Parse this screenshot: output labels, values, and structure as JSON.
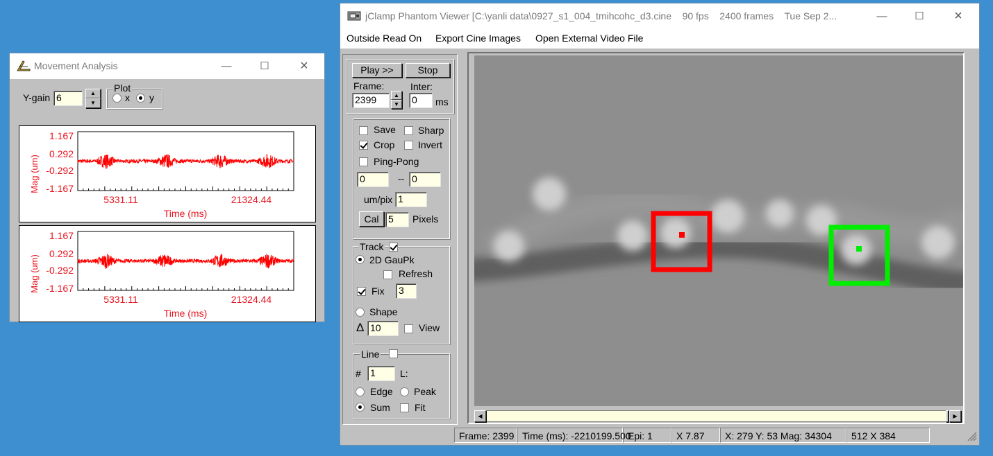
{
  "movement": {
    "title": "Movement Analysis",
    "ygain_label": "Y-gain",
    "ygain_value": "6",
    "plot_group_label": "Plot",
    "plot_x_label": "x",
    "plot_y_label": "y",
    "plot_selected": "y"
  },
  "chart_data": [
    {
      "type": "line",
      "ylabel": "Mag (um)",
      "xlabel": "Time (ms)",
      "yticks": [
        "1.167",
        "0.292",
        "-0.292",
        "-1.167"
      ],
      "xticks": [
        "5331.11",
        "21324.44"
      ],
      "ylim": [
        -1.167,
        1.167
      ],
      "series_color": "#ff0000",
      "bursts": [
        0.13,
        0.41,
        0.66,
        0.88
      ]
    },
    {
      "type": "line",
      "ylabel": "Mag (um)",
      "xlabel": "Time (ms)",
      "yticks": [
        "1.167",
        "0.292",
        "-0.292",
        "-1.167"
      ],
      "xticks": [
        "5331.11",
        "21324.44"
      ],
      "ylim": [
        -1.167,
        1.167
      ],
      "series_color": "#ff0000",
      "bursts": [
        0.13,
        0.4,
        0.66,
        0.88
      ]
    }
  ],
  "viewer": {
    "title": "jClamp Phantom Viewer [C:\\yanli data\\0927_s1_004_tmihcohc_d3.cine    90 fps    2400 frames    Tue Sep 2...",
    "menu": [
      "Outside Read On",
      "Export Cine Images",
      "Open External Video File"
    ],
    "play_label": "Play >>",
    "stop_label": "Stop",
    "frame_label": "Frame:",
    "frame_value": "2399",
    "inter_label": "Inter:",
    "inter_value": "0",
    "inter_unit": "ms",
    "save_label": "Save",
    "sharp_label": "Sharp",
    "crop_label": "Crop",
    "invert_label": "Invert",
    "pingpong_label": "Ping-Pong",
    "range_from": "0",
    "range_sep": "--",
    "range_to": "0",
    "umpix_label": "um/pix",
    "umpix_value": "1",
    "cal_label": "Cal",
    "cal_value": "5",
    "pixels_label": "Pixels",
    "track_label": "Track",
    "gaupk_label": "2D GauPk",
    "refresh_label": "Refresh",
    "fix_label": "Fix",
    "fix_value": "3",
    "shape_label": "Shape",
    "delta_symbol": "Δ",
    "delta_value": "10",
    "view_label": "View",
    "line_label": "Line",
    "hash_label": "#",
    "line_num": "1",
    "l_label": "L:",
    "edge_label": "Edge",
    "peak_label": "Peak",
    "sum_label": "Sum",
    "fit_label": "Fit",
    "status": {
      "frame": "Frame:  2399",
      "time": "Time (ms): -2210199.500",
      "epi": "Epi:  1",
      "x": "X 7.87",
      "xy": "X:  279  Y:  53  Mag:  34304",
      "size": "512 X 384"
    },
    "roi_red_color": "#ff0000",
    "roi_green_color": "#00ee00"
  }
}
